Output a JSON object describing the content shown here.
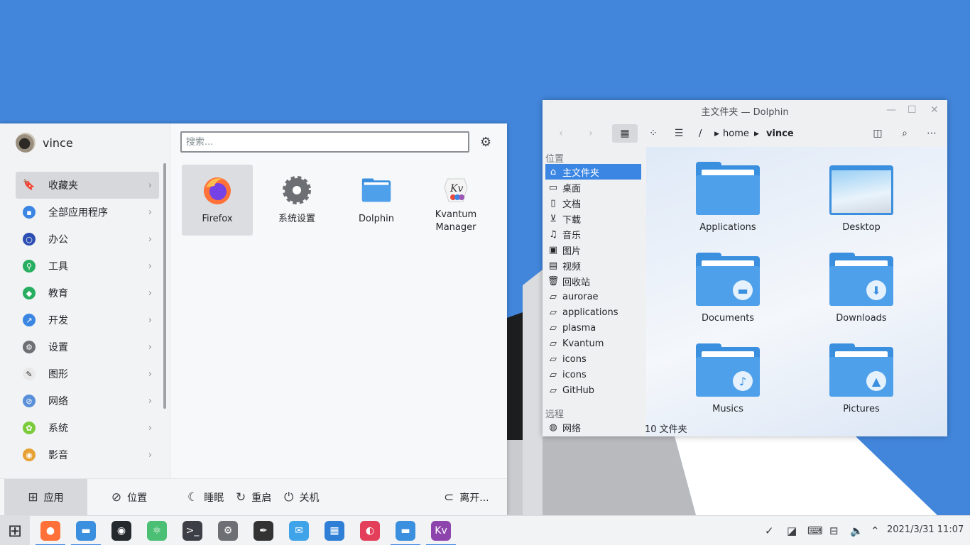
{
  "launcher": {
    "user_name": "vince",
    "search_placeholder": "搜索...",
    "categories": [
      {
        "label": "收藏夹",
        "color": "#5b5e62"
      },
      {
        "label": "全部应用程序",
        "color": "#3b86e3"
      },
      {
        "label": "办公",
        "color": "#2d4fb3"
      },
      {
        "label": "工具",
        "color": "#27ae60"
      },
      {
        "label": "教育",
        "color": "#27ae60"
      },
      {
        "label": "开发",
        "color": "#3b86e3"
      },
      {
        "label": "设置",
        "color": "#6c6f73"
      },
      {
        "label": "图形",
        "color": "#e9e9e9"
      },
      {
        "label": "网络",
        "color": "#5a8fd9"
      },
      {
        "label": "系统",
        "color": "#7ccb3c"
      },
      {
        "label": "影音",
        "color": "#e6a132"
      }
    ],
    "apps": [
      {
        "label": "Firefox",
        "icon": "firefox-icon"
      },
      {
        "label": "系统设置",
        "icon": "settings-icon"
      },
      {
        "label": "Dolphin",
        "icon": "folder-icon"
      },
      {
        "label": "Kvantum\nManager",
        "icon": "kvantum-icon"
      }
    ],
    "footer": {
      "apps_tab": "应用",
      "places_tab": "位置",
      "sleep": "睡眠",
      "restart": "重启",
      "shutdown": "关机",
      "leave": "离开..."
    }
  },
  "dolphin": {
    "title": "主文件夹 — Dolphin",
    "breadcrumb": {
      "root": "/",
      "home": "home",
      "current": "vince"
    },
    "places_header": "位置",
    "remote_header": "远程",
    "places": [
      {
        "label": "主文件夹",
        "icon": "home-icon"
      },
      {
        "label": "桌面",
        "icon": "desktop-icon"
      },
      {
        "label": "文档",
        "icon": "document-icon"
      },
      {
        "label": "下载",
        "icon": "download-icon"
      },
      {
        "label": "音乐",
        "icon": "music-icon"
      },
      {
        "label": "图片",
        "icon": "image-icon"
      },
      {
        "label": "视频",
        "icon": "video-icon"
      },
      {
        "label": "回收站",
        "icon": "trash-icon"
      },
      {
        "label": "aurorae",
        "icon": "folder-icon"
      },
      {
        "label": "applications",
        "icon": "folder-icon"
      },
      {
        "label": "plasma",
        "icon": "folder-icon"
      },
      {
        "label": "Kvantum",
        "icon": "folder-icon"
      },
      {
        "label": "icons",
        "icon": "folder-icon"
      },
      {
        "label": "icons",
        "icon": "folder-icon"
      },
      {
        "label": "GitHub",
        "icon": "folder-icon"
      }
    ],
    "remote": [
      {
        "label": "网络",
        "icon": "network-icon"
      }
    ],
    "files": [
      {
        "label": "Applications"
      },
      {
        "label": "Desktop"
      },
      {
        "label": "Documents"
      },
      {
        "label": "Downloads"
      },
      {
        "label": "Musics"
      },
      {
        "label": "Pictures"
      }
    ],
    "status": "10 文件夹"
  },
  "taskbar": {
    "clock": "2021/3/31  11:07",
    "items": [
      {
        "name": "start-menu-icon",
        "color": "#2c2f33"
      },
      {
        "name": "firefox-icon",
        "color": "#ff7139"
      },
      {
        "name": "files-icon",
        "color": "#3b8fdf"
      },
      {
        "name": "github-icon",
        "color": "#24292e"
      },
      {
        "name": "atom-icon",
        "color": "#4bbf73"
      },
      {
        "name": "terminal-icon",
        "color": "#3c4046"
      },
      {
        "name": "settings-icon",
        "color": "#6c6f73"
      },
      {
        "name": "inkscape-icon",
        "color": "#333333"
      },
      {
        "name": "mail-icon",
        "color": "#3ea3e8"
      },
      {
        "name": "virtualbox-icon",
        "color": "#2f7fd6"
      },
      {
        "name": "kvantum-app-icon",
        "color": "#e43f5a"
      },
      {
        "name": "dolphin-icon",
        "color": "#3b8fdf"
      },
      {
        "name": "kvantum-manager-icon",
        "color": "#8e44ad"
      }
    ]
  }
}
